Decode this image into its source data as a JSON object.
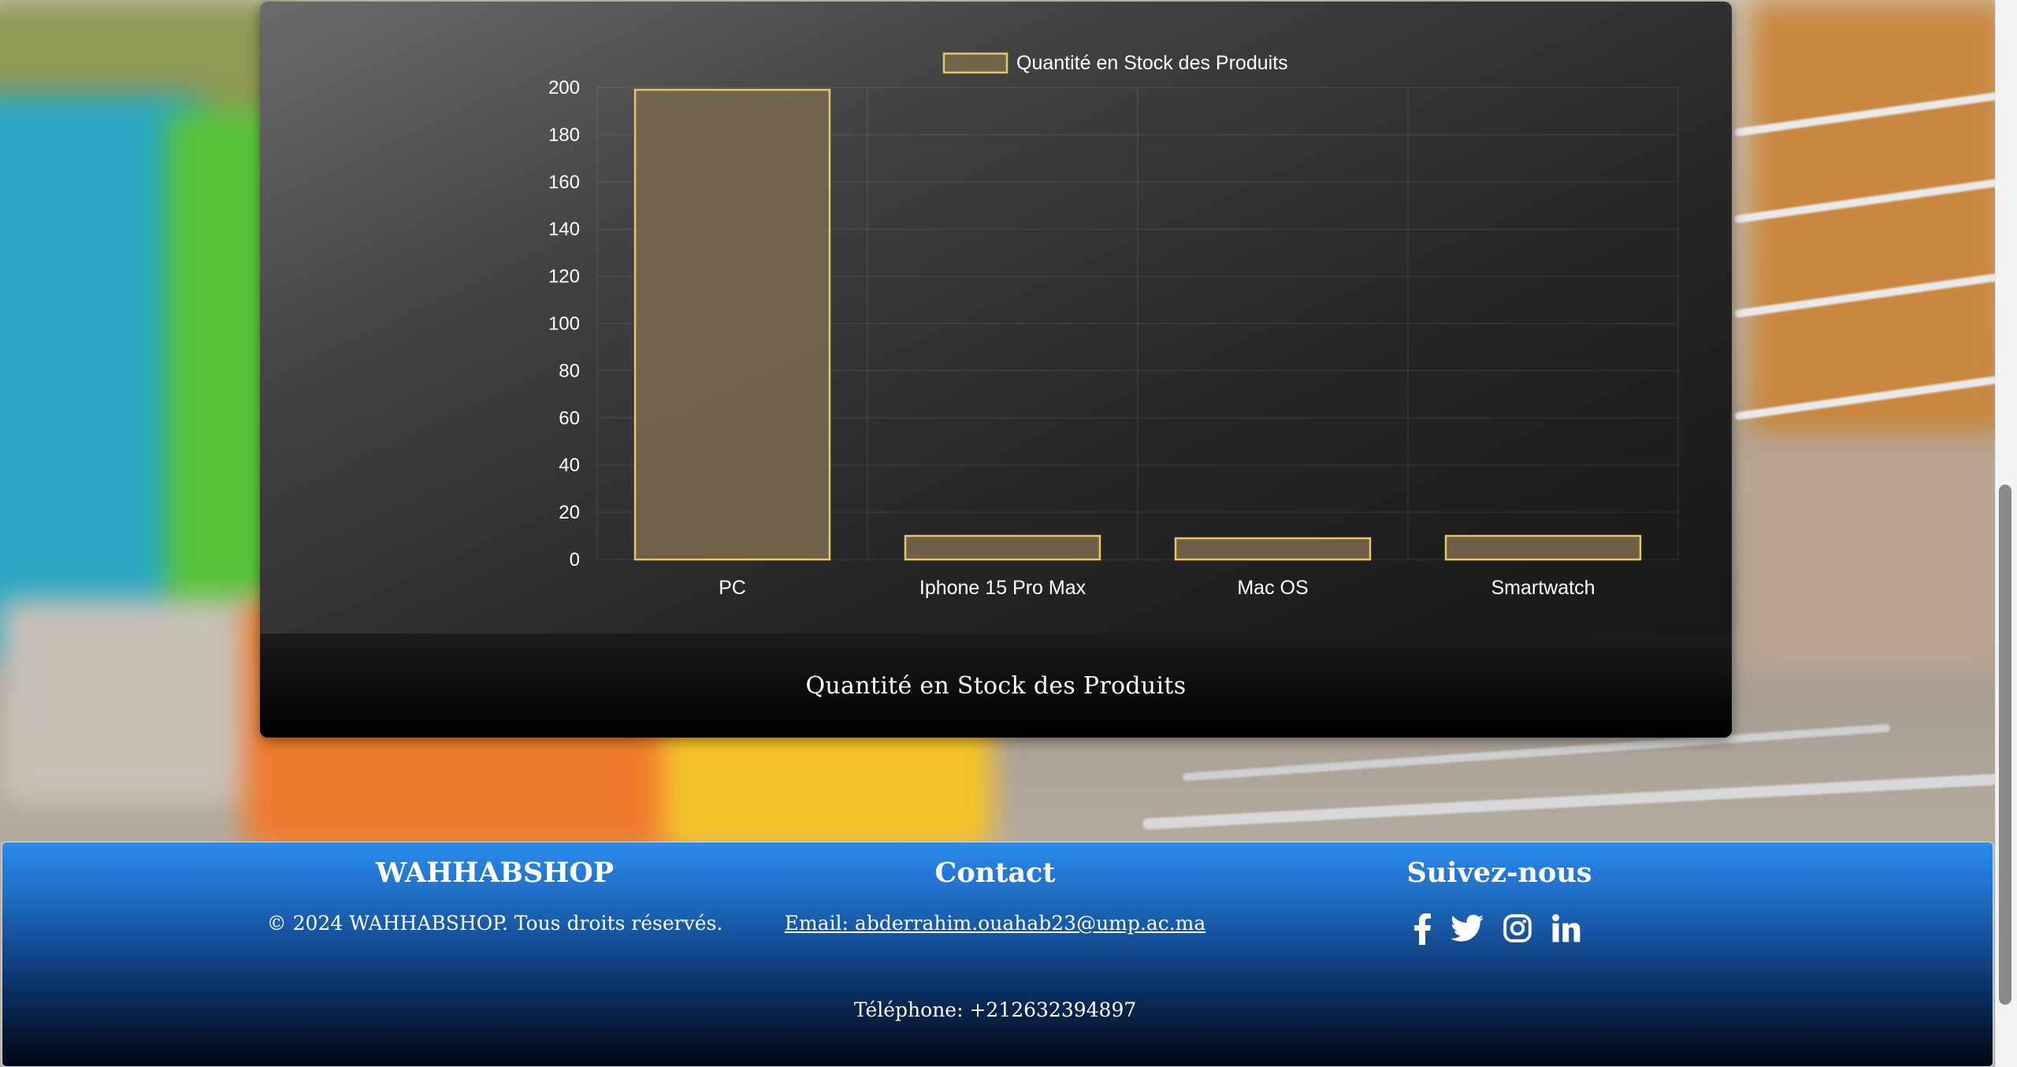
{
  "chart_data": {
    "type": "bar",
    "categories": [
      "PC",
      "Iphone 15 Pro Max",
      "Mac OS",
      "Smartwatch"
    ],
    "series": [
      {
        "name": "Quantité en Stock des Produits",
        "values": [
          199,
          10,
          9,
          10
        ]
      }
    ],
    "ylim": [
      0,
      200
    ],
    "yticks": [
      0,
      20,
      40,
      60,
      80,
      100,
      120,
      140,
      160,
      180,
      200
    ],
    "legend": "top-center",
    "grid": true,
    "bar_fill": "#7a6b4e",
    "bar_stroke": "#e8c46a"
  },
  "card": {
    "caption": "Quantité en Stock des Produits"
  },
  "footer": {
    "brand": {
      "title": "WAHHABSHOP",
      "copyright": "© 2024 WAHHABSHOP. Tous droits réservés."
    },
    "contact": {
      "title": "Contact",
      "email": "Email: abderrahim.ouahab23@ump.ac.ma",
      "phone": "Téléphone: +212632394897"
    },
    "social": {
      "title": "Suivez-nous",
      "icons": [
        "facebook-icon",
        "twitter-icon",
        "instagram-icon",
        "linkedin-icon"
      ]
    },
    "colors": {
      "top": "#2b8cf0",
      "bottom": "#020611"
    }
  }
}
